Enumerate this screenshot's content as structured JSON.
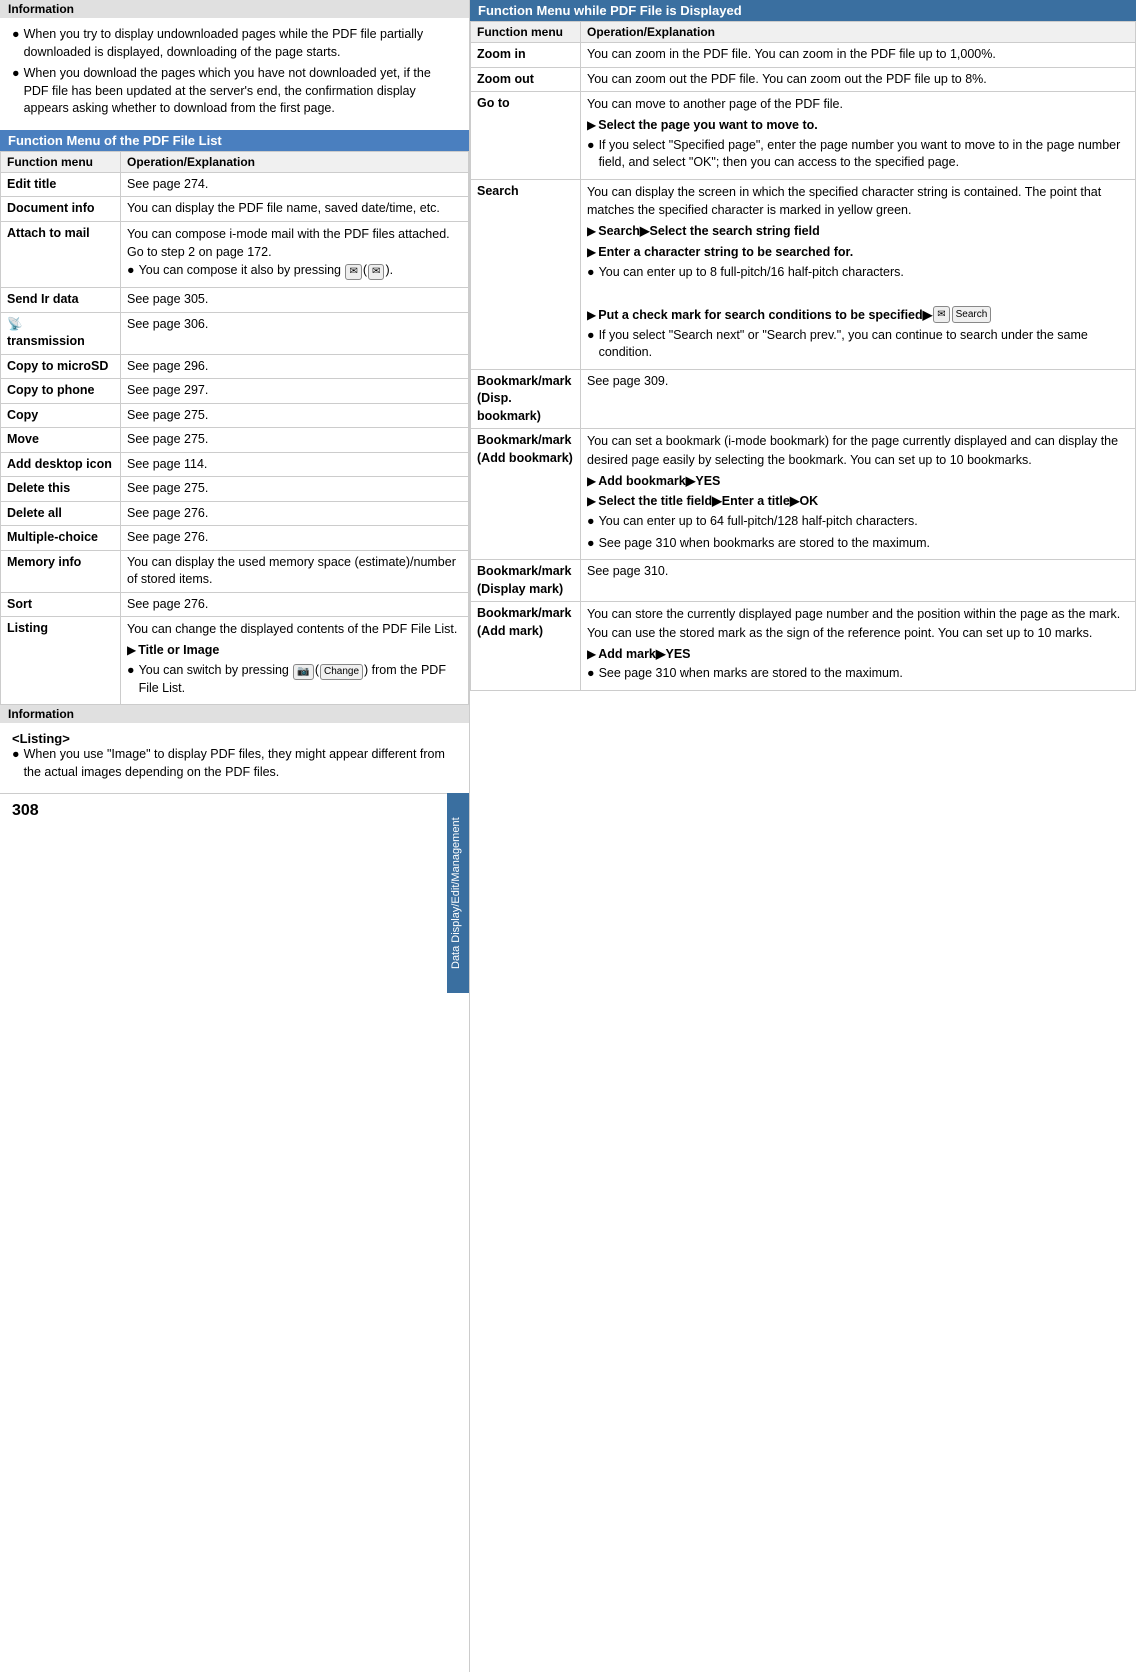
{
  "page_number": "308",
  "sidebar_label": "Data Display/Edit/Management",
  "left": {
    "info_box_1": {
      "label": "Information",
      "items": [
        "When you try to display undownloaded pages while the PDF file partially downloaded is displayed, downloading of the page starts.",
        "When you download the pages which you have not downloaded yet, if the PDF file has been updated at the server's end, the confirmation display appears asking whether to download from the first page."
      ]
    },
    "section1": {
      "title": "Function Menu of the PDF File List",
      "col1": "Function menu",
      "col2": "Operation/Explanation",
      "rows": [
        {
          "menu": "Edit title",
          "desc": "See page 274."
        },
        {
          "menu": "Document info",
          "desc": "You can display the PDF file name, saved date/time, etc."
        },
        {
          "menu": "Attach to mail",
          "desc_parts": [
            "You can compose i-mode mail with the PDF files attached.",
            "Go to step 2 on page 172.",
            "●You can compose it also by pressing"
          ]
        },
        {
          "menu": "Send Ir data",
          "desc": "See page 305."
        },
        {
          "menu": "transmission_icon",
          "desc": "See page 306."
        },
        {
          "menu": "Copy to microSD",
          "desc": "See page 296."
        },
        {
          "menu": "Copy to phone",
          "desc": "See page 297."
        },
        {
          "menu": "Copy",
          "desc": "See page 275."
        },
        {
          "menu": "Move",
          "desc": "See page 275."
        },
        {
          "menu": "Add desktop icon",
          "desc": "See page 114."
        },
        {
          "menu": "Delete this",
          "desc": "See page 275."
        },
        {
          "menu": "Delete all",
          "desc": "See page 276."
        },
        {
          "menu": "Multiple-choice",
          "desc": "See page 276."
        },
        {
          "menu": "Memory info",
          "desc": "You can display the used memory space (estimate)/number of stored items."
        },
        {
          "menu": "Sort",
          "desc": "See page 276."
        },
        {
          "menu": "Listing",
          "desc_parts": [
            "You can change the displayed contents of the PDF File List.",
            "▶Title or Image",
            "●You can switch by pressing"
          ]
        }
      ]
    },
    "info_box_2": {
      "label": "Information",
      "listing_header": "<Listing>",
      "listing_item": "When you use \"Image\" to display PDF files, they might appear different from the actual images depending on the PDF files."
    }
  },
  "right": {
    "section_title": "Function Menu while PDF File is Displayed",
    "col1": "Function menu",
    "col2": "Operation/Explanation",
    "rows": [
      {
        "menu": "Zoom in",
        "desc": "You can zoom in the PDF file. You can zoom in the PDF file up to 1,000%."
      },
      {
        "menu": "Zoom out",
        "desc": "You can zoom out the PDF file. You can zoom out the PDF file up to 8%."
      },
      {
        "menu": "Go to",
        "desc_parts": [
          "You can move to another page of the PDF file.",
          "▶Select the page you want to move to.",
          "●If you select \"Specified page\", enter the page number you want to move to in the page number field, and select \"OK\"; then you can access to the specified page."
        ]
      },
      {
        "menu": "Search",
        "desc_parts": [
          "You can display the screen in which the specified character string is contained. The point that matches the specified character is marked in yellow green.",
          "▶Search▶Select the search string field",
          "▶Enter a character string to be searched for.",
          "●You can enter up to 8 full-pitch/16 half-pitch characters.",
          "",
          "▶Put a check mark for search conditions to be specified▶",
          "●If you select \"Search next\" or \"Search prev.\", you can continue to search under the same condition."
        ]
      },
      {
        "menu": "Bookmark/mark\n(Disp.\nbookmark)",
        "desc": "See page 309."
      },
      {
        "menu": "Bookmark/mark\n(Add bookmark)",
        "desc_parts": [
          "You can set a bookmark (i-mode bookmark) for the page currently displayed and can display the desired page easily by selecting the bookmark. You can set up to 10 bookmarks.",
          "▶Add bookmark▶YES",
          "▶Select the title field▶Enter a title▶OK",
          "●You can enter up to 64 full-pitch/128 half-pitch characters.",
          "●See page 310 when bookmarks are stored to the maximum."
        ]
      },
      {
        "menu": "Bookmark/mark\n(Display mark)",
        "desc": "See page 310."
      },
      {
        "menu": "Bookmark/mark\n(Add mark)",
        "desc_parts": [
          "You can store the currently displayed page number and the position within the page as the mark. You can use the stored mark as the sign of the reference point. You can set up to 10 marks.",
          "▶Add mark▶YES",
          "●See page 310 when marks are stored to the maximum."
        ]
      }
    ]
  }
}
